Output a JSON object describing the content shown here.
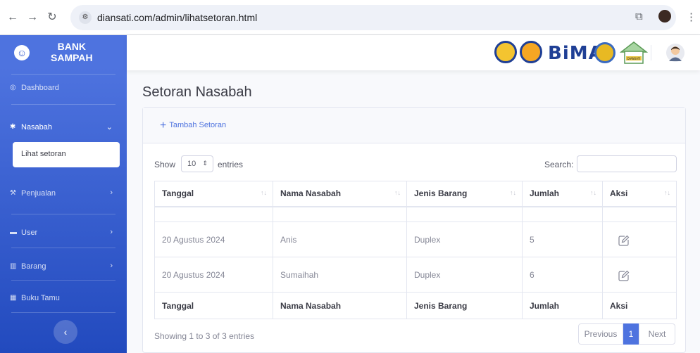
{
  "browser": {
    "url": "diansati.com/admin/lihatsetoran.html"
  },
  "brand": {
    "line1": "BANK",
    "line2": "SAMPAH"
  },
  "sidebar": {
    "items": [
      {
        "label": "Dashboard"
      },
      {
        "label": "Nasabah"
      },
      {
        "label": "Penjualan"
      },
      {
        "label": "User"
      },
      {
        "label": "Barang"
      },
      {
        "label": "Buku Tamu"
      }
    ],
    "submenu_label": "Lihat setoran"
  },
  "topbar": {
    "logo_text": "BiMA",
    "house_label": "DIANSATI"
  },
  "page": {
    "title": "Setoran Nasabah",
    "add_button": "Tambah Setoran"
  },
  "table_controls": {
    "show": "Show",
    "length_value": "10",
    "entries": "entries",
    "search_label": "Search:"
  },
  "table": {
    "headers": [
      "Tanggal",
      "Nama Nasabah",
      "Jenis Barang",
      "Jumlah",
      "Aksi"
    ],
    "rows": [
      {
        "tanggal": "20 Agustus 2024",
        "nama": "Anis",
        "jenis": "Duplex",
        "jumlah": "5"
      },
      {
        "tanggal": "20 Agustus 2024",
        "nama": "Sumaihah",
        "jenis": "Duplex",
        "jumlah": "6"
      }
    ],
    "footers": [
      "Tanggal",
      "Nama Nasabah",
      "Jenis Barang",
      "Jumlah",
      "Aksi"
    ]
  },
  "footer": {
    "info": "Showing 1 to 3 of 3 entries",
    "previous": "Previous",
    "current_page": "1",
    "next": "Next"
  },
  "colors": {
    "primary": "#4e73df",
    "sidebar_dark": "#224abe"
  }
}
